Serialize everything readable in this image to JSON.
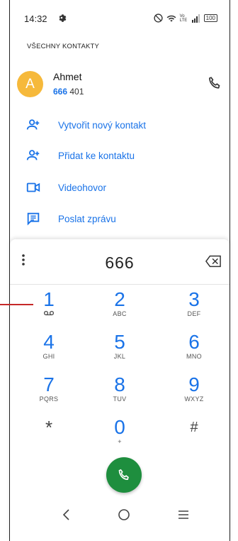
{
  "status": {
    "time": "14:32",
    "battery": "100",
    "volte": "Vo LTE"
  },
  "section_title": "VŠECHNY KONTAKTY",
  "contact": {
    "initial": "A",
    "name": "Ahmet",
    "number_match": "666",
    "number_rest": " 401"
  },
  "actions": [
    {
      "label": "Vytvořit nový kontakt",
      "icon": "person-add-icon"
    },
    {
      "label": "Přidat ke kontaktu",
      "icon": "person-add-icon"
    },
    {
      "label": "Videohovor",
      "icon": "videocam-icon"
    },
    {
      "label": "Poslat zprávu",
      "icon": "message-icon"
    }
  ],
  "dial": {
    "number": "666",
    "keys": [
      {
        "digit": "1",
        "letters": "voicemail"
      },
      {
        "digit": "2",
        "letters": "ABC"
      },
      {
        "digit": "3",
        "letters": "DEF"
      },
      {
        "digit": "4",
        "letters": "GHI"
      },
      {
        "digit": "5",
        "letters": "JKL"
      },
      {
        "digit": "6",
        "letters": "MNO"
      },
      {
        "digit": "7",
        "letters": "PQRS"
      },
      {
        "digit": "8",
        "letters": "TUV"
      },
      {
        "digit": "9",
        "letters": "WXYZ"
      },
      {
        "digit": "*",
        "letters": ""
      },
      {
        "digit": "0",
        "letters": "+"
      },
      {
        "digit": "#",
        "letters": ""
      }
    ]
  },
  "colors": {
    "accent": "#1a73e8",
    "call_green": "#1e8e3e",
    "avatar": "#f6b93b"
  }
}
